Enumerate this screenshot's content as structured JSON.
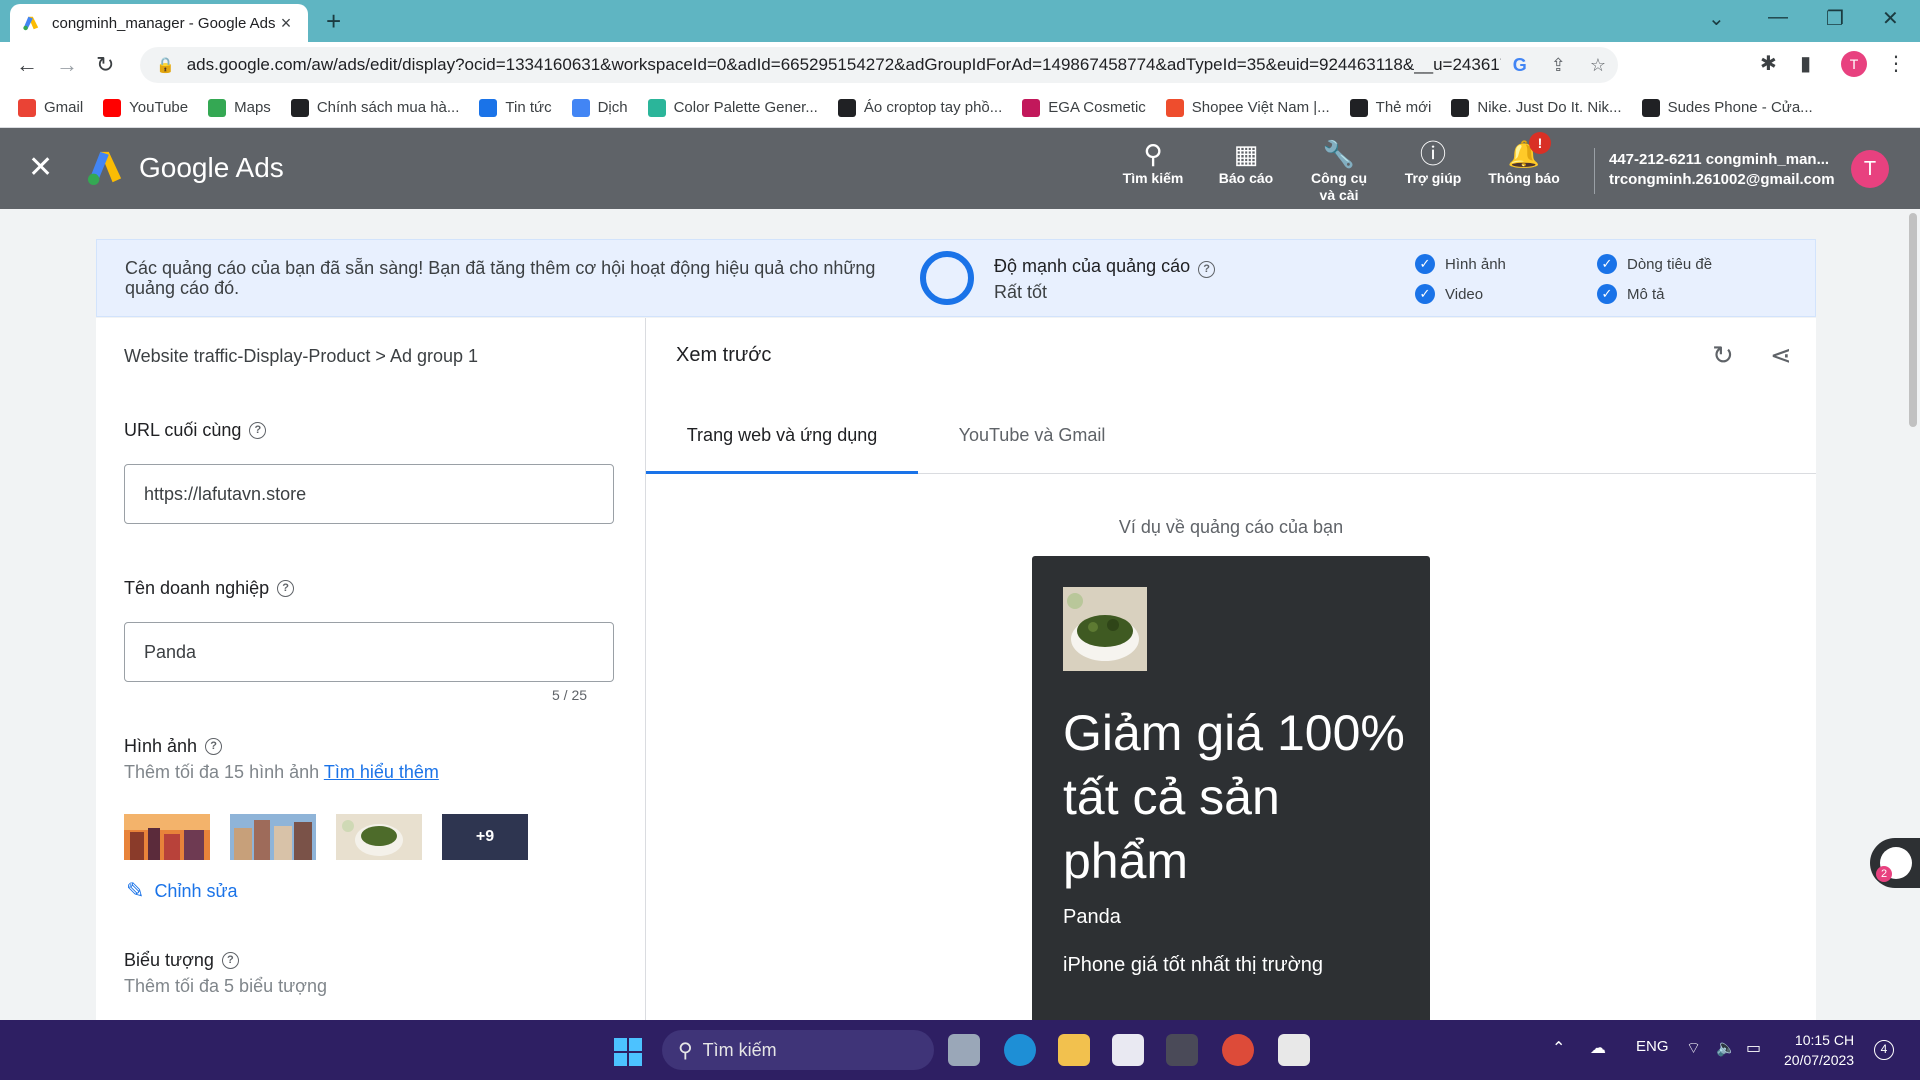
{
  "browser": {
    "tab_title": "congminh_manager - Google Ads",
    "new_tab": "+",
    "tab_close": "×",
    "url": "ads.google.com/aw/ads/edit/display?ocid=1334160631&workspaceId=0&adId=665295154272&adGroupIdForAd=149867458774&adTypeId=35&euid=924463118&__u=2436177182&...",
    "profile_initial": "T",
    "bookmarks": [
      {
        "label": "Gmail",
        "icon": "gmail-icon",
        "color": "#ea4335"
      },
      {
        "label": "YouTube",
        "icon": "youtube-icon",
        "color": "#ff0000"
      },
      {
        "label": "Maps",
        "icon": "maps-icon",
        "color": "#34a853"
      },
      {
        "label": "Chính sách mua hà...",
        "icon": "policy-icon",
        "color": "#202124"
      },
      {
        "label": "Tin tức",
        "icon": "news-icon",
        "color": "#1a73e8"
      },
      {
        "label": "Dịch",
        "icon": "translate-icon",
        "color": "#4285f4"
      },
      {
        "label": "Color Palette Gener...",
        "icon": "palette-icon",
        "color": "#2bb59a"
      },
      {
        "label": "Áo croptop tay phồ...",
        "icon": "shop-icon",
        "color": "#202124"
      },
      {
        "label": "EGA Cosmetic",
        "icon": "ega-icon",
        "color": "#c2185b"
      },
      {
        "label": "Shopee Việt Nam |...",
        "icon": "shopee-icon",
        "color": "#ee4d2d"
      },
      {
        "label": "Thẻ mới",
        "icon": "globe-icon",
        "color": "#202124"
      },
      {
        "label": "Nike. Just Do It. Nik...",
        "icon": "nike-icon",
        "color": "#202124"
      },
      {
        "label": "Sudes Phone - Cửa...",
        "icon": "sudes-icon",
        "color": "#202124"
      }
    ]
  },
  "ads_header": {
    "brand": "Google Ads",
    "items": [
      {
        "label": "Tìm kiếm",
        "icon": "search-icon"
      },
      {
        "label": "Báo cáo",
        "icon": "report-icon"
      },
      {
        "label": "Công cụ và cài",
        "icon": "tools-icon"
      },
      {
        "label": "Trợ giúp",
        "icon": "help-icon"
      },
      {
        "label": "Thông báo",
        "icon": "bell-icon"
      }
    ],
    "notification_badge": "!",
    "account_id": "447-212-6211 congminh_man...",
    "account_email": "trcongminh.261002@gmail.com",
    "avatar_initial": "T"
  },
  "banner": {
    "message": "Các quảng cáo của bạn đã sẵn sàng! Bạn đã tăng thêm cơ hội hoạt động hiệu quả cho những quảng cáo đó.",
    "strength_title": "Độ mạnh của quảng cáo",
    "strength_value": "Rất tốt",
    "checks": [
      "Hình ảnh",
      "Dòng tiêu đề",
      "Video",
      "Mô tả"
    ]
  },
  "form": {
    "breadcrumb": "Website traffic-Display-Product > Ad group 1",
    "final_url_label": "URL cuối cùng",
    "final_url_value": "https://lafutavn.store",
    "business_label": "Tên doanh nghiệp",
    "business_value": "Panda",
    "business_counter": "5 / 25",
    "images_label": "Hình ảnh",
    "images_sub": "Thêm tối đa 15 hình ảnh",
    "images_link": "Tìm hiểu thêm",
    "more_images": "+9",
    "edit_label": "Chỉnh sửa",
    "logo_label": "Biểu tượng",
    "logo_sub": "Thêm tối đa 5 biểu tượng"
  },
  "preview": {
    "title": "Xem trước",
    "tabs": [
      "Trang web và ứng dụng",
      "YouTube và Gmail"
    ],
    "example_label": "Ví dụ về quảng cáo của bạn",
    "headline": "Giảm giá 100% tất cả sản phẩm",
    "business": "Panda",
    "description": "iPhone giá tốt nhất thị trường"
  },
  "taskbar": {
    "search_label": "Tìm kiếm",
    "lang": "ENG",
    "time": "10:15 CH",
    "date": "20/07/2023",
    "notif_count": "4"
  }
}
